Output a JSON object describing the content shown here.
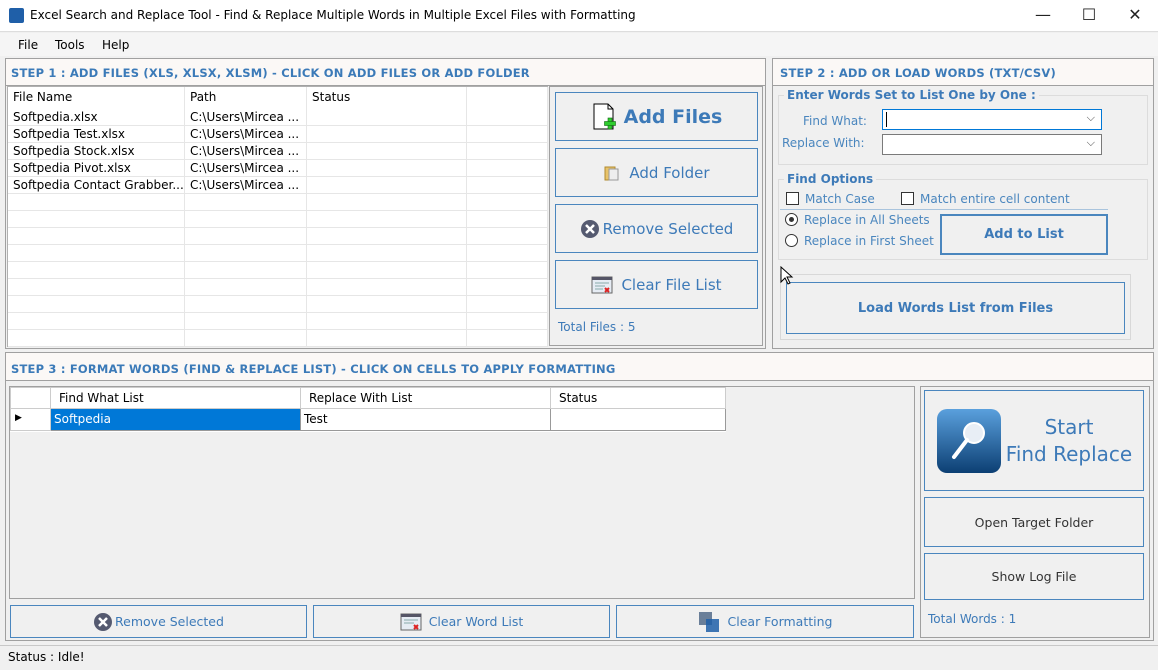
{
  "window": {
    "title": "Excel Search and Replace Tool - Find & Replace Multiple Words in Multiple Excel Files with Formatting",
    "minimize": "—",
    "maximize": "☐",
    "close": "✕"
  },
  "menu": [
    "File",
    "Tools",
    "Help"
  ],
  "step1": {
    "header": "STEP 1 : ADD FILES (XLS, XLSX, XLSM) - CLICK ON ADD FILES OR ADD FOLDER",
    "columns": [
      "File Name",
      "Path",
      "Status"
    ],
    "rows": [
      [
        "Softpedia.xlsx",
        "C:\\Users\\Mircea ...",
        ""
      ],
      [
        "Softpedia Test.xlsx",
        "C:\\Users\\Mircea ...",
        ""
      ],
      [
        "Softpedia Stock.xlsx",
        "C:\\Users\\Mircea ...",
        ""
      ],
      [
        "Softpedia Pivot.xlsx",
        "C:\\Users\\Mircea ...",
        ""
      ],
      [
        "Softpedia Contact Grabber....",
        "C:\\Users\\Mircea ...",
        ""
      ]
    ],
    "add_files": "Add Files",
    "add_folder": "Add Folder",
    "remove_selected": "Remove Selected",
    "clear_file_list": "Clear File List",
    "total_files": "Total Files : 5"
  },
  "step2": {
    "header": "STEP 2 : ADD OR LOAD WORDS (TXT/CSV)",
    "group_enter": "Enter Words Set to List One by One :",
    "find_what_label": "Find What:",
    "find_what_value": "",
    "replace_with_label": "Replace With:",
    "replace_with_value": "",
    "group_options": "Find Options",
    "match_case": "Match Case",
    "match_case_checked": false,
    "match_entire": "Match entire cell content",
    "match_entire_checked": false,
    "replace_all": "Replace in All Sheets",
    "replace_first": "Replace in First Sheet",
    "selected_scope": "Replace in All Sheets",
    "add_to_list": "Add to List",
    "load_words": "Load Words List from Files"
  },
  "step3": {
    "header": "STEP 3 : FORMAT WORDS (FIND & REPLACE LIST) - CLICK ON CELLS TO APPLY FORMATTING",
    "columns": [
      "Find What List",
      "Replace With List",
      "Status"
    ],
    "rows": [
      [
        "Softpedia",
        "Test",
        ""
      ]
    ],
    "remove_selected": "Remove Selected",
    "clear_word_list": "Clear Word List",
    "clear_formatting": "Clear Formatting",
    "start_line1": "Start",
    "start_line2": "Find Replace",
    "open_target": "Open Target Folder",
    "show_log": "Show Log File",
    "total_words": "Total Words : 1"
  },
  "status": {
    "text": "Status :  Idle!"
  },
  "colors": {
    "accent": "#3d7ab8",
    "selection": "#0078d7"
  }
}
